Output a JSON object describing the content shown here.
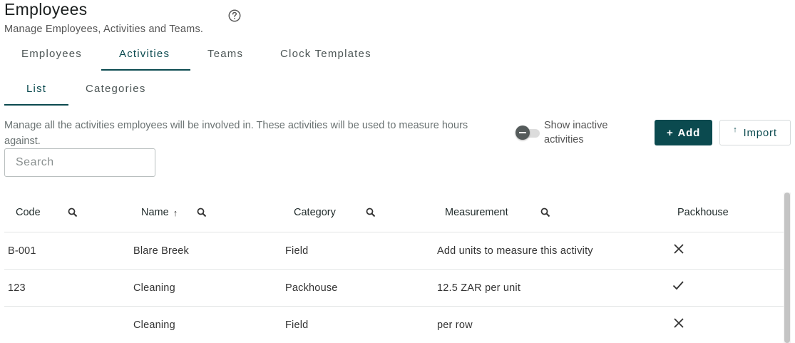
{
  "header": {
    "title": "Employees",
    "subtitle": "Manage Employees, Activities and Teams.",
    "help_icon": "help-circle-icon"
  },
  "tabs": [
    {
      "label": "Employees",
      "active": false
    },
    {
      "label": "Activities",
      "active": true
    },
    {
      "label": "Teams",
      "active": false
    },
    {
      "label": "Clock Templates",
      "active": false
    }
  ],
  "subtabs": [
    {
      "label": "List",
      "active": true
    },
    {
      "label": "Categories",
      "active": false
    }
  ],
  "description": "Manage all the activities employees will be involved in. These activities will be used to measure hours against.",
  "toggle": {
    "label": "Show inactive activities",
    "checked": false
  },
  "buttons": {
    "add_label": "Add",
    "add_icon": "plus-icon",
    "import_label": "Import",
    "import_icon": "upload-arrow-icon"
  },
  "search": {
    "placeholder": "Search",
    "value": ""
  },
  "table": {
    "columns": [
      {
        "label": "Code",
        "searchable": true
      },
      {
        "label": "Name",
        "searchable": true,
        "sort": "asc"
      },
      {
        "label": "Category",
        "searchable": true
      },
      {
        "label": "Measurement",
        "searchable": true
      },
      {
        "label": "Packhouse",
        "searchable": false
      }
    ],
    "rows": [
      {
        "code": "B-001",
        "name": "Blare Breek",
        "category": "Field",
        "measurement": "Add units to measure this activity",
        "packhouse": false
      },
      {
        "code": "123",
        "name": "Cleaning",
        "category": "Packhouse",
        "measurement": "12.5 ZAR per unit",
        "packhouse": true
      },
      {
        "code": "",
        "name": "Cleaning",
        "category": "Field",
        "measurement": "per row",
        "packhouse": false
      }
    ]
  },
  "colors": {
    "accent": "#0b4a4f",
    "border": "#e3e6e6"
  }
}
